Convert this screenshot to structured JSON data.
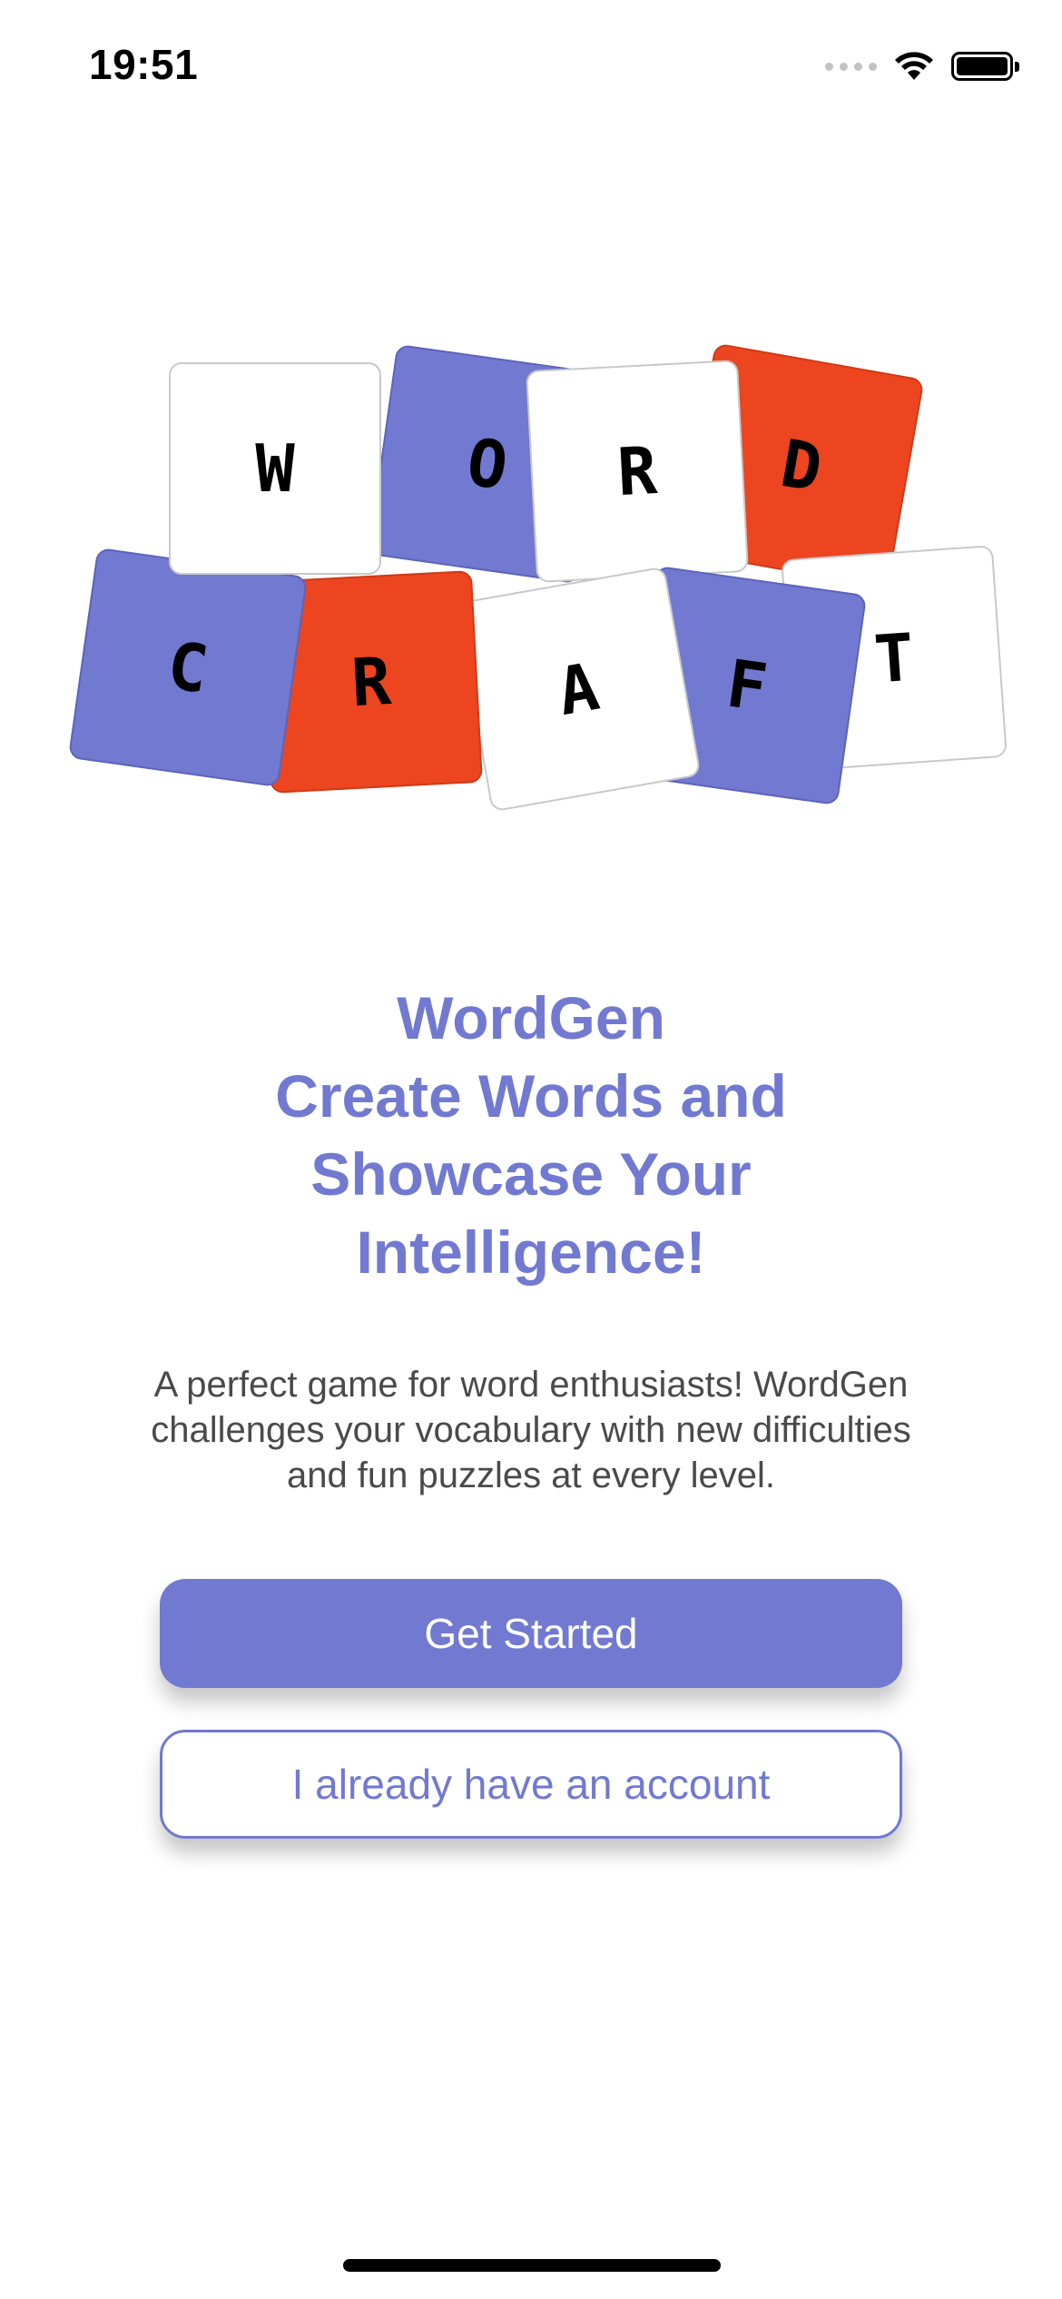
{
  "status_bar": {
    "time": "19:51",
    "icons": [
      "signal-icon",
      "wifi-icon",
      "battery-icon"
    ]
  },
  "logo": {
    "row1": [
      {
        "letter": "W",
        "color": "white"
      },
      {
        "letter": "O",
        "color": "blue"
      },
      {
        "letter": "R",
        "color": "white"
      },
      {
        "letter": "D",
        "color": "red"
      }
    ],
    "row2": [
      {
        "letter": "C",
        "color": "blue"
      },
      {
        "letter": "R",
        "color": "red"
      },
      {
        "letter": "A",
        "color": "white"
      },
      {
        "letter": "F",
        "color": "blue"
      },
      {
        "letter": "T",
        "color": "white"
      }
    ]
  },
  "headline": {
    "line1": "WordGen",
    "line2": "Create Words and",
    "line3": "Showcase Your",
    "line4": "Intelligence!"
  },
  "description": "A perfect game for word enthusiasts! WordGen challenges your vocabulary with new difficulties and fun puzzles at every level.",
  "buttons": {
    "primary_label": "Get Started",
    "secondary_label": "I already have an account"
  },
  "colors": {
    "accent": "#7179d1",
    "tile_red": "#ec4520",
    "tile_white": "#ffffff",
    "text_dark": "#4a4a4a"
  }
}
